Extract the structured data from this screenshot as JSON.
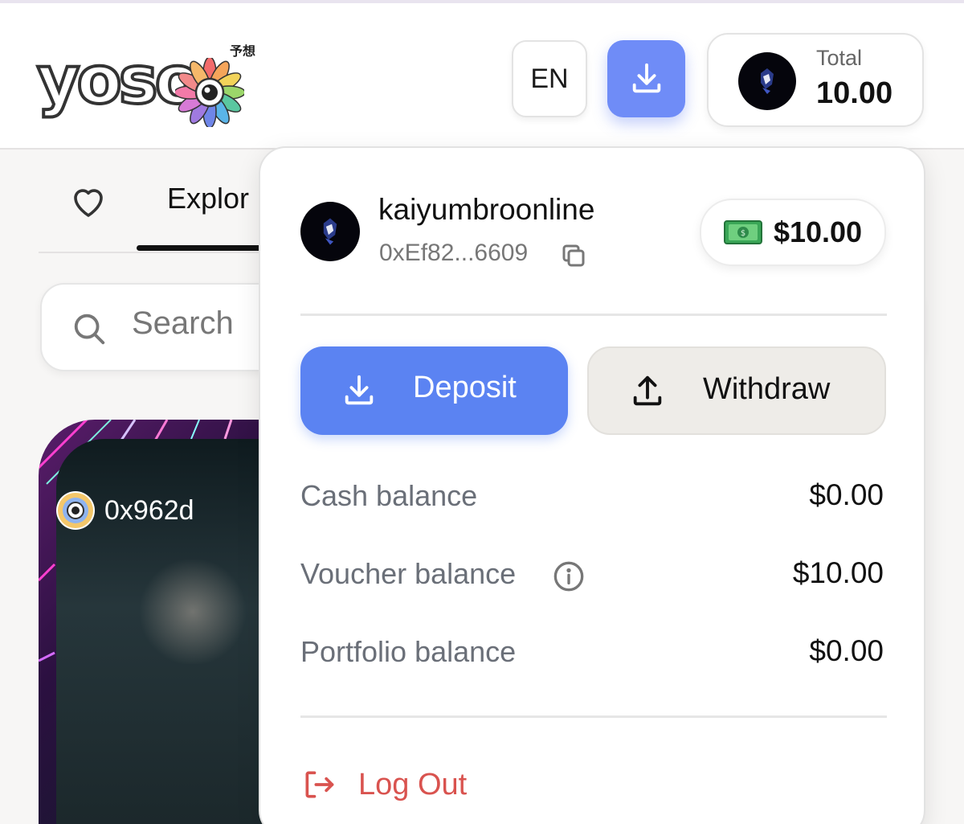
{
  "header": {
    "logo_text": "yoso",
    "logo_subtext": "予想",
    "language_button": "EN",
    "download_icon": "download-icon",
    "total_label": "Total",
    "total_value": "10.00"
  },
  "background": {
    "favorites_icon": "heart-icon",
    "tab_explore": "Explor",
    "search_placeholder": "Search",
    "card_owner": "0x962d"
  },
  "account_menu": {
    "username": "kaiyumbroonline",
    "address": "0xEf82...6609",
    "copy_icon": "copy-icon",
    "pill_icon": "money-icon",
    "pill_amount": "$10.00",
    "deposit_label": "Deposit",
    "withdraw_label": "Withdraw",
    "balances": [
      {
        "label": "Cash balance",
        "value": "$0.00"
      },
      {
        "label": "Voucher balance",
        "value": "$10.00"
      },
      {
        "label": "Portfolio balance",
        "value": "$0.00"
      }
    ],
    "logout_label": "Log Out"
  },
  "colors": {
    "accent": "#5b83f2",
    "accent_light": "#6f8cf7",
    "logout": "#d9534f",
    "muted_text": "#6a6f78"
  }
}
